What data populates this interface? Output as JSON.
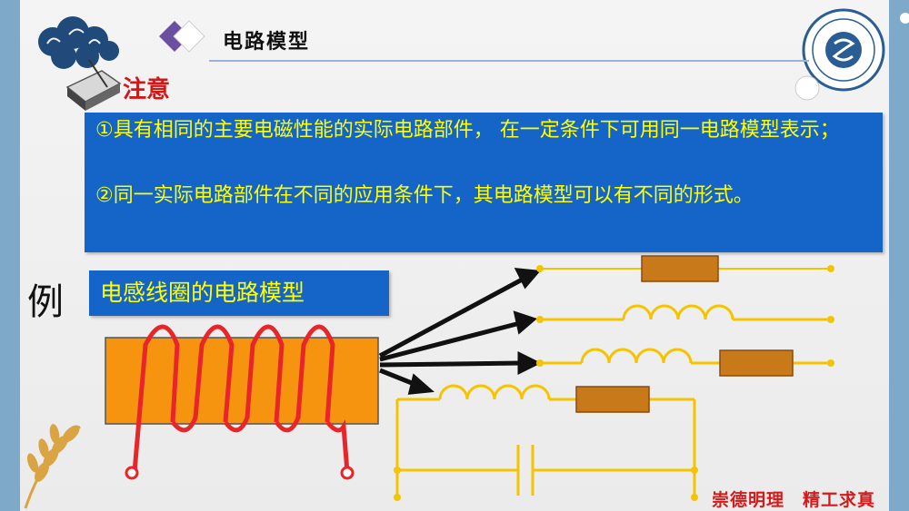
{
  "header": {
    "title": "电路模型"
  },
  "note": {
    "title": "注意"
  },
  "points": [
    "①具有相同的主要电磁性能的实际电路部件，  在一定条件下可用同一电路模型表示；",
    "②同一实际电路部件在不同的应用条件下，其电路模型可以有不同的形式。"
  ],
  "example": {
    "label": "例",
    "caption": "电感线圈的电路模型"
  },
  "footer": {
    "motto": "崇德明理　精工求真"
  },
  "colors": {
    "blue_box": "#1565c8",
    "yellow_text": "#ffff00",
    "wire": "#f5c400",
    "coil": "#e8262a",
    "core": "#f7940f"
  }
}
